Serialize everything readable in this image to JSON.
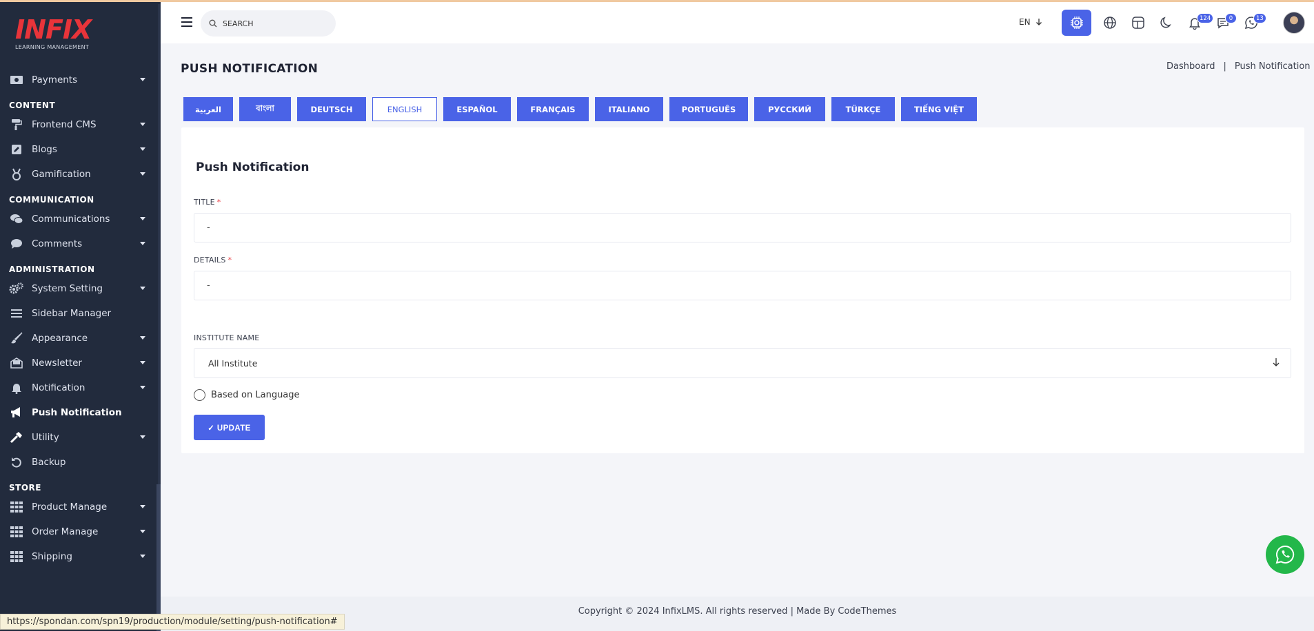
{
  "app": {
    "brand": "INFIX",
    "tagline": "LEARNING MANAGEMENT"
  },
  "sidebar": {
    "sections": [
      {
        "title": "",
        "items": [
          {
            "label": "Payments",
            "icon": "money-icon",
            "has_caret": true
          }
        ]
      },
      {
        "title": "CONTENT",
        "items": [
          {
            "label": "Frontend CMS",
            "icon": "paint-roller-icon",
            "has_caret": true
          },
          {
            "label": "Blogs",
            "icon": "edit-icon",
            "has_caret": true
          },
          {
            "label": "Gamification",
            "icon": "medal-icon",
            "has_caret": true
          }
        ]
      },
      {
        "title": "COMMUNICATION",
        "items": [
          {
            "label": "Communications",
            "icon": "chat-bubbles-icon",
            "has_caret": true
          },
          {
            "label": "Comments",
            "icon": "comment-icon",
            "has_caret": true
          }
        ]
      },
      {
        "title": "ADMINISTRATION",
        "items": [
          {
            "label": "System Setting",
            "icon": "gears-icon",
            "has_caret": true
          },
          {
            "label": "Sidebar Manager",
            "icon": "menu-lines-icon",
            "has_caret": false
          },
          {
            "label": "Appearance",
            "icon": "brush-icon",
            "has_caret": true
          },
          {
            "label": "Newsletter",
            "icon": "envelope-open-icon",
            "has_caret": true
          },
          {
            "label": "Notification",
            "icon": "bell-icon",
            "has_caret": true
          },
          {
            "label": "Push Notification",
            "icon": "megaphone-icon",
            "has_caret": false,
            "active": true
          },
          {
            "label": "Utility",
            "icon": "hammer-icon",
            "has_caret": true
          },
          {
            "label": "Backup",
            "icon": "undo-icon",
            "has_caret": false
          }
        ]
      },
      {
        "title": "STORE",
        "items": [
          {
            "label": "Product Manage",
            "icon": "grid-icon",
            "has_caret": true
          },
          {
            "label": "Order Manage",
            "icon": "grid-icon",
            "has_caret": true
          },
          {
            "label": "Shipping",
            "icon": "grid-icon",
            "has_caret": true
          }
        ]
      }
    ]
  },
  "header": {
    "search_placeholder": "SEARCH",
    "language": "EN",
    "badges": {
      "notifications": "124",
      "messages": "0",
      "whatsapp": "13"
    }
  },
  "page": {
    "title": "PUSH NOTIFICATION",
    "breadcrumb": [
      "Dashboard",
      "|",
      "Push Notification"
    ]
  },
  "languages": [
    {
      "label": "العربية",
      "width": 72
    },
    {
      "label": "বাংলা",
      "width": 75
    },
    {
      "label": "DEUTSCH",
      "width": 100
    },
    {
      "label": "ENGLISH",
      "width": 94,
      "selected": true
    },
    {
      "label": "ESPAÑOL",
      "width": 98
    },
    {
      "label": "FRANÇAIS",
      "width": 104
    },
    {
      "label": "ITALIANO",
      "width": 99
    },
    {
      "label": "PORTUGUÊS",
      "width": 114
    },
    {
      "label": "РУССКИЙ",
      "width": 103
    },
    {
      "label": "TÜRKÇE",
      "width": 92
    },
    {
      "label": "TIẾNG VIỆT",
      "width": 110
    }
  ],
  "form": {
    "card_title": "Push Notification",
    "title_label": "TITLE",
    "title_value": "-",
    "details_label": "DETAILS",
    "details_value": "-",
    "required_mark": "*",
    "institute_label": "INSTITUTE NAME",
    "institute_value": "All Institute",
    "radio_label": "Based on Language",
    "update_button": "✓ UPDATE"
  },
  "footer": {
    "text": "Copyright © 2024 InfixLMS. All rights reserved | Made By CodeThemes"
  },
  "status_bar": {
    "url": "https://spondan.com/spn19/production/module/setting/push-notification#"
  },
  "colors": {
    "accent": "#4a63e7",
    "sidebar_bg": "#222b3d",
    "brand_red": "#e8343a",
    "whatsapp": "#23b74a"
  }
}
